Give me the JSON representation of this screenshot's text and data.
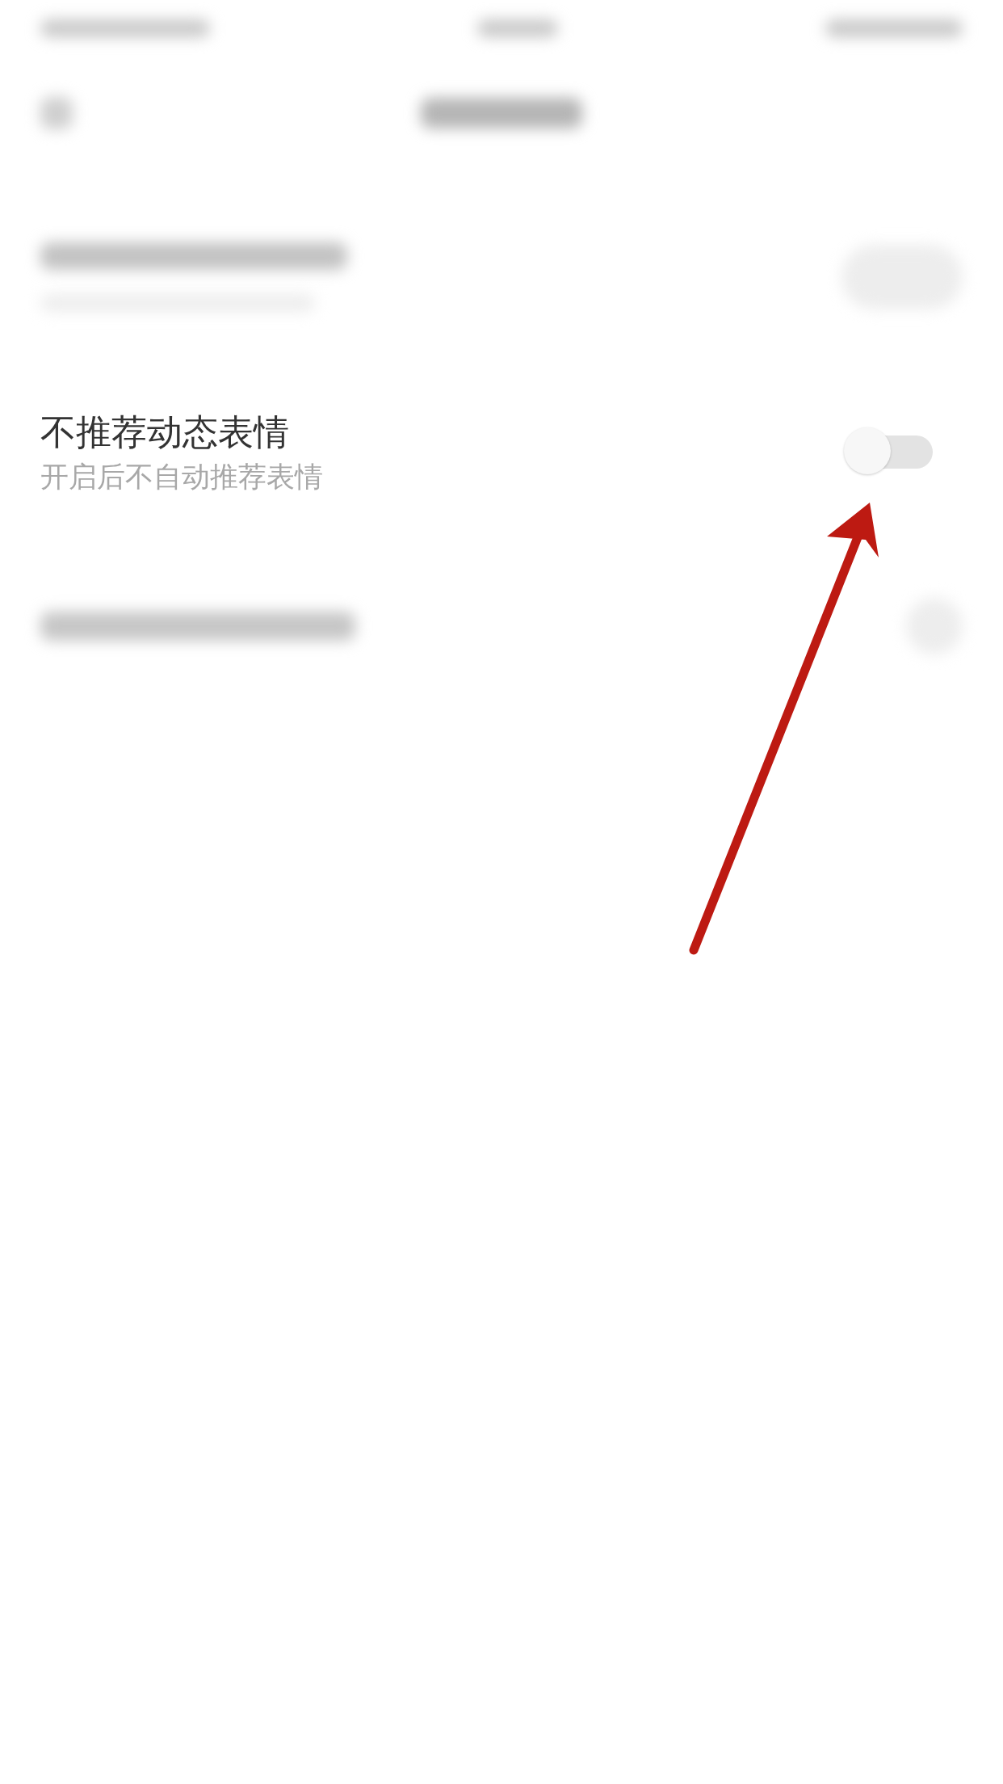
{
  "setting": {
    "title": "不推荐动态表情",
    "subtitle": "开启后不自动推荐表情",
    "on": false
  },
  "annotation": {
    "kind": "arrow"
  }
}
